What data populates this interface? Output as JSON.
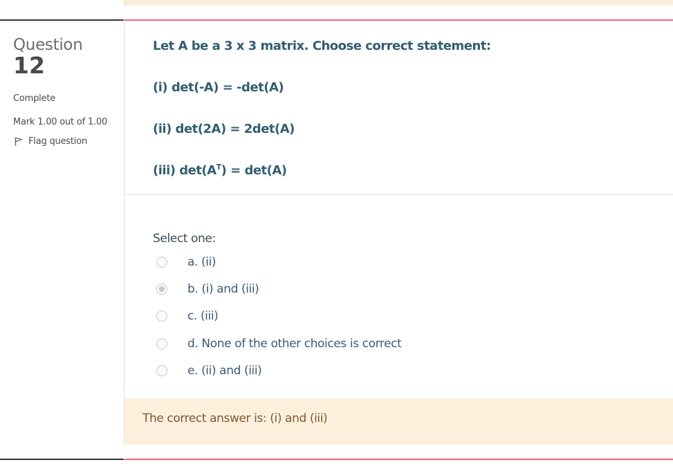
{
  "question": {
    "label": "Question",
    "number": "12",
    "state": "Complete",
    "grade": "Mark 1.00 out of 1.00",
    "flag_label": "Flag question"
  },
  "qtext": {
    "statement": "Let A be a 3 x 3 matrix. Choose correct statement:",
    "item1": "(i) det(-A) = -det(A)",
    "item2": "(ii) det(2A) = 2det(A)",
    "item3_prefix": "(iii) det(A",
    "item3_sup": "T",
    "item3_suffix": ") = det(A)"
  },
  "answer_block": {
    "prompt": "Select one:",
    "options": [
      {
        "label": "a. (ii)",
        "checked": false
      },
      {
        "label": "b. (i) and (iii)",
        "checked": true
      },
      {
        "label": "c. (iii)",
        "checked": false
      },
      {
        "label": "d. None of the other choices is correct",
        "checked": false
      },
      {
        "label": "e. (ii) and (iii)",
        "checked": false
      }
    ]
  },
  "feedback": {
    "right_answer": "The correct answer is: (i) and (iii)"
  },
  "colors": {
    "accent_rule": "#f0637b",
    "question_text": "#315e71",
    "feedback_bg": "#fcefdc"
  },
  "icons": {
    "flag": "flag-icon"
  }
}
